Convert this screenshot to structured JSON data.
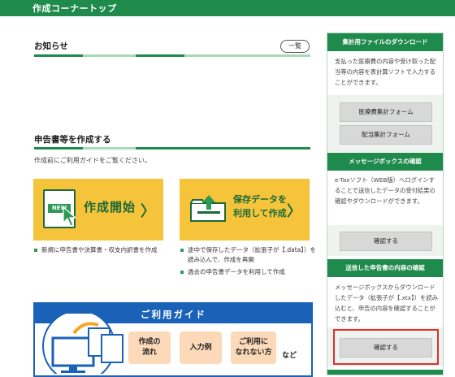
{
  "header": {
    "title": "作成コーナートップ"
  },
  "notice": {
    "title": "お知らせ",
    "list_button": "一覧"
  },
  "create_section": {
    "title": "申告書等を作成する",
    "lead": "作成前にご利用ガイドをご覧ください。",
    "card_new": {
      "badge": "NEW",
      "label": "作成開始",
      "caret": "〉"
    },
    "card_saved": {
      "label_line1": "保存データを",
      "label_line2": "利用して作成",
      "caret": "〉"
    },
    "bullets_new": [
      "新規に申告書や決算書・収支内訳書を作成"
    ],
    "bullets_saved": [
      "途中で保存したデータ（拡張子が【.data】）を読み込んで、作成を再開",
      "過去の申告書データを利用して作成"
    ]
  },
  "guide": {
    "title": "ご利用ガイド",
    "btn1_line1": "作成の",
    "btn1_line2": "流れ",
    "btn2": "入力例",
    "btn3_line1": "ご利用に",
    "btn3_line2": "なれない方",
    "nado": "など"
  },
  "sidebar": {
    "sec1": {
      "title": "集計用ファイルのダウンロード",
      "desc": "支払った医療費の内容や受け取った配当等の内容を表計算ソフトで入力することができます。",
      "btn1": "医療費集計フォーム",
      "btn2": "配当集計フォーム"
    },
    "sec2": {
      "title": "メッセージボックスの確認",
      "desc": "e-Taxソフト（WEB版）へログインすることで送信したデータの受付結果の確認やダウンロードができます。",
      "btn": "確認する"
    },
    "sec3": {
      "title": "送信した申告書の内容の確認",
      "desc": "メッセージボックスからダウンロードしたデータ（拡張子が【.xtx】）を読み込むと、申告の内容を確認することができます。",
      "btn": "確認する"
    }
  },
  "colors": {
    "brand_green": "#1e8a4c",
    "card_yellow": "#f5c43a",
    "guide_blue": "#1a62b8",
    "highlight_red": "#e03030"
  },
  "icons": [
    "new-document-icon",
    "pointer-cursor-icon",
    "folder-upload-icon",
    "monitor-documents-icon",
    "chevron-right-icon"
  ]
}
